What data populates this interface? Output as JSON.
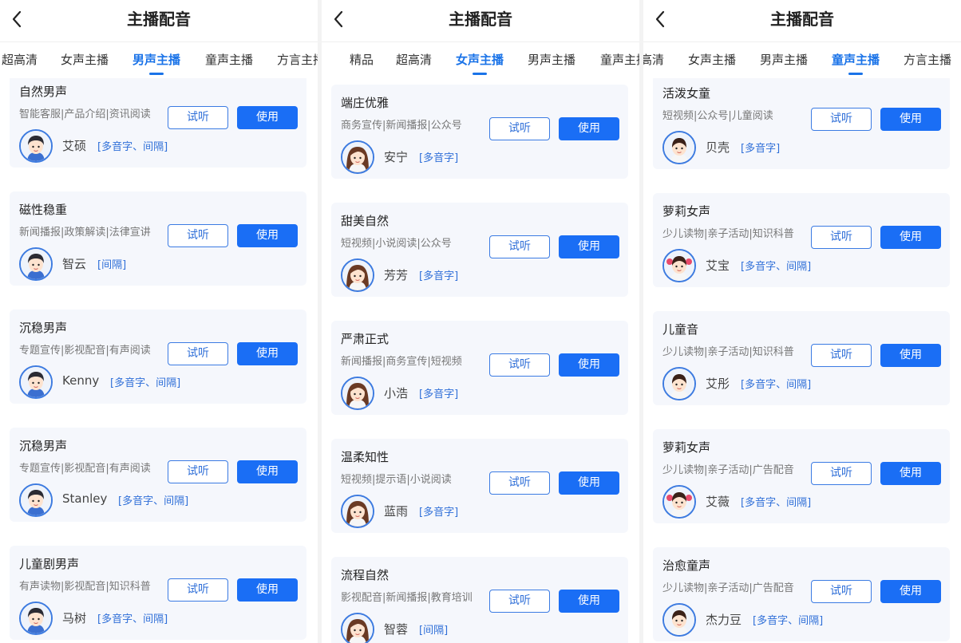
{
  "panels": [
    {
      "title": "主播配音",
      "tabs": [
        "超高清",
        "女声主播",
        "男声主播",
        "童声主播",
        "方言主播"
      ],
      "active_tab": 2,
      "avatar_style": "boy",
      "cards": [
        {
          "name": "自然男声",
          "tags": "智能客服|产品介绍|资讯阅读",
          "voice": "艾硕",
          "features": "[多音字、间隔]"
        },
        {
          "name": "磁性稳重",
          "tags": "新闻播报|政策解读|法律宣讲",
          "voice": "智云",
          "features": "[间隔]"
        },
        {
          "name": "沉稳男声",
          "tags": "专题宣传|影视配音|有声阅读",
          "voice": "Kenny",
          "features": "[多音字、间隔]"
        },
        {
          "name": "沉稳男声",
          "tags": "专题宣传|影视配音|有声阅读",
          "voice": "Stanley",
          "features": "[多音字、间隔]"
        },
        {
          "name": "儿童剧男声",
          "tags": "有声读物|影视配音|知识科普",
          "voice": "马树",
          "features": "[多音字、间隔]"
        }
      ]
    },
    {
      "title": "主播配音",
      "tabs": [
        "精品",
        "超高清",
        "女声主播",
        "男声主播",
        "童声主播"
      ],
      "active_tab": 2,
      "avatar_style": "woman",
      "cards": [
        {
          "name": "端庄优雅",
          "tags": "商务宣传|新闻播报|公众号",
          "voice": "安宁",
          "features": "[多音字]"
        },
        {
          "name": "甜美自然",
          "tags": "短视频|小说阅读|公众号",
          "voice": "芳芳",
          "features": "[多音字]"
        },
        {
          "name": "严肃正式",
          "tags": "新闻播报|商务宣传|短视频",
          "voice": "小浩",
          "features": "[多音字]"
        },
        {
          "name": "温柔知性",
          "tags": "短视频|提示语|小说阅读",
          "voice": "蓝雨",
          "features": "[多音字]"
        },
        {
          "name": "流程自然",
          "tags": "影视配音|新闻播报|教育培训",
          "voice": "智蓉",
          "features": "[间隔]"
        }
      ]
    },
    {
      "title": "主播配音",
      "tabs": [
        "高清",
        "女声主播",
        "男声主播",
        "童声主播",
        "方言主播"
      ],
      "active_tab": 3,
      "avatar_style": "child",
      "cards": [
        {
          "name": "活泼女童",
          "tags": "短视频|公众号|儿童阅读",
          "voice": "贝壳",
          "features": "[多音字]"
        },
        {
          "name": "萝莉女声",
          "tags": "少儿读物|亲子活动|知识科普",
          "voice": "艾宝",
          "features": "[多音字、间隔]"
        },
        {
          "name": "儿童音",
          "tags": "少儿读物|亲子活动|知识科普",
          "voice": "艾彤",
          "features": "[多音字、间隔]"
        },
        {
          "name": "萝莉女声",
          "tags": "少儿读物|亲子活动|广告配音",
          "voice": "艾薇",
          "features": "[多音字、间隔]"
        },
        {
          "name": "治愈童声",
          "tags": "少儿读物|亲子活动|广告配音",
          "voice": "杰力豆",
          "features": "[多音字、间隔]"
        }
      ]
    }
  ],
  "buttons": {
    "try_label": "试听",
    "use_label": "使用"
  },
  "icons": {
    "back": "chevron-left-icon"
  },
  "colors": {
    "accent": "#1a73e8",
    "button_fill": "#1a6ef5",
    "card_bg": "#f5f7fc"
  }
}
